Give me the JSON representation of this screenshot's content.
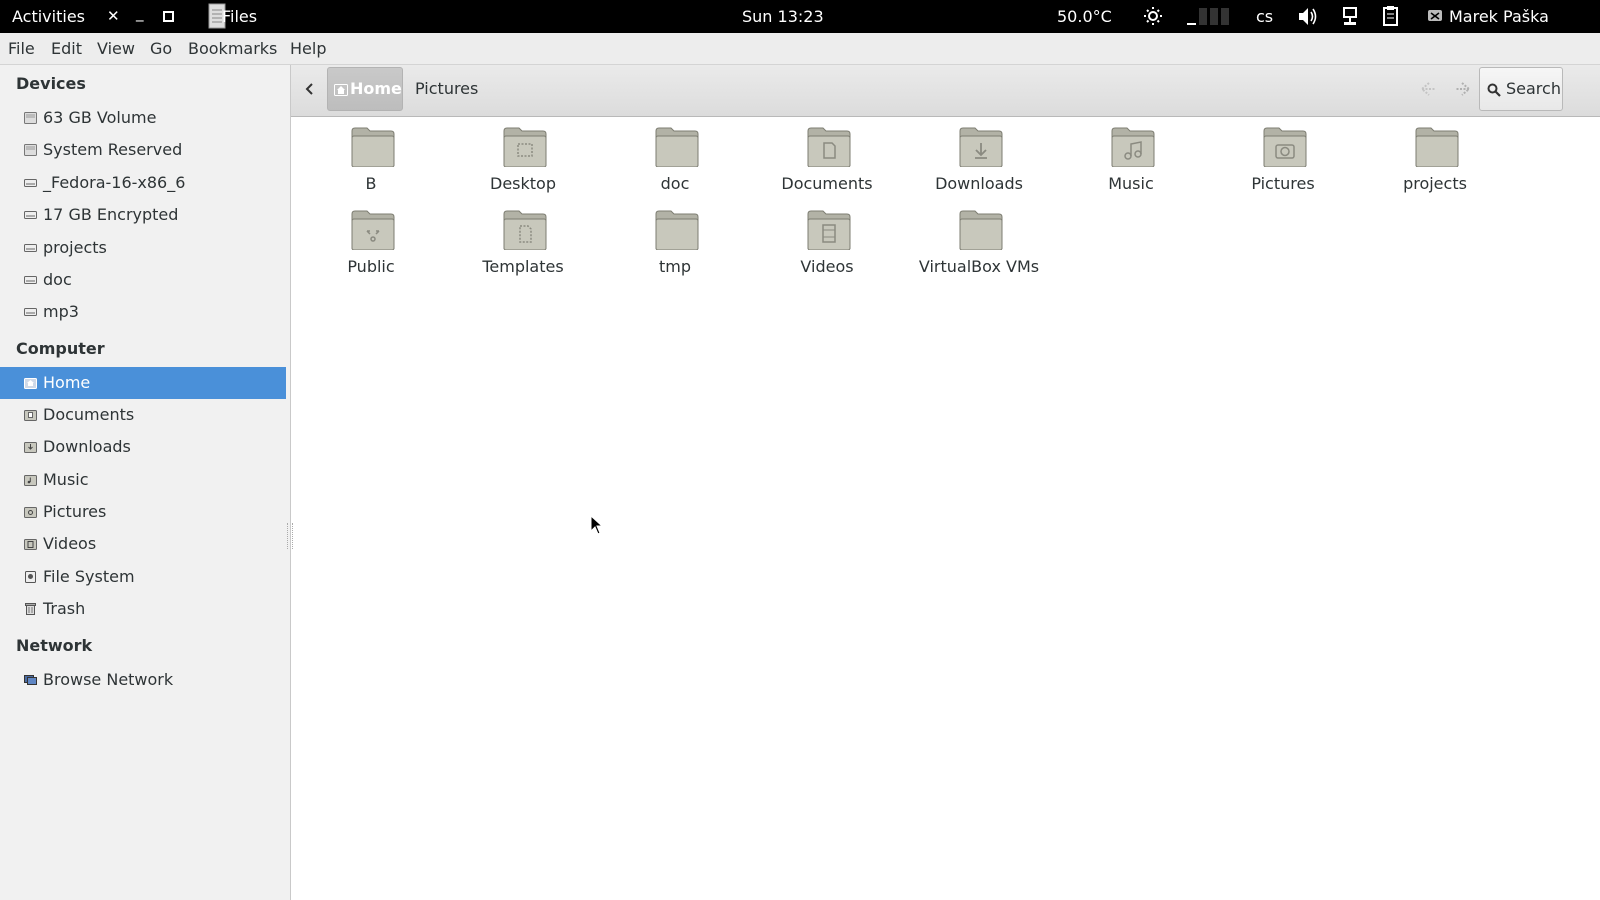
{
  "top_panel": {
    "activities": "Activities",
    "app_name": "Files",
    "clock": "Sun 13:23",
    "temperature": "50.0°C",
    "keyboard_layout": "cs",
    "user_name": "Marek Paška",
    "icons": [
      "close-icon",
      "minimize-icon",
      "maximize-icon",
      "files-app-icon",
      "brightness-icon",
      "battery-icon",
      "volume-icon",
      "network-icon",
      "clipboard-icon",
      "user-icon"
    ]
  },
  "menu": {
    "items": [
      "File",
      "Edit",
      "View",
      "Go",
      "Bookmarks",
      "Help"
    ]
  },
  "sidebar": {
    "sections": [
      {
        "title": "Devices",
        "items": [
          {
            "label": "63 GB Volume",
            "icon": "drive-icon"
          },
          {
            "label": "System Reserved",
            "icon": "drive-icon"
          },
          {
            "label": "_Fedora-16-x86_6",
            "icon": "drive-icon"
          },
          {
            "label": "17 GB Encrypted",
            "icon": "drive-icon"
          },
          {
            "label": "projects",
            "icon": "drive-icon"
          },
          {
            "label": "doc",
            "icon": "drive-icon"
          },
          {
            "label": "mp3",
            "icon": "drive-icon"
          }
        ]
      },
      {
        "title": "Computer",
        "items": [
          {
            "label": "Home",
            "icon": "home-folder-icon",
            "active": true
          },
          {
            "label": "Documents",
            "icon": "documents-folder-icon"
          },
          {
            "label": "Downloads",
            "icon": "downloads-folder-icon"
          },
          {
            "label": "Music",
            "icon": "music-folder-icon"
          },
          {
            "label": "Pictures",
            "icon": "pictures-folder-icon"
          },
          {
            "label": "Videos",
            "icon": "videos-folder-icon"
          },
          {
            "label": "File System",
            "icon": "filesystem-icon"
          },
          {
            "label": "Trash",
            "icon": "trash-icon"
          }
        ]
      },
      {
        "title": "Network",
        "items": [
          {
            "label": "Browse Network",
            "icon": "network-icon"
          }
        ]
      }
    ]
  },
  "toolbar": {
    "breadcrumb": [
      "Home",
      "Pictures"
    ],
    "search_label": "Search"
  },
  "files": [
    {
      "name": "B",
      "icon": "folder"
    },
    {
      "name": "Desktop",
      "icon": "desktop"
    },
    {
      "name": "doc",
      "icon": "folder"
    },
    {
      "name": "Documents",
      "icon": "documents"
    },
    {
      "name": "Downloads",
      "icon": "downloads"
    },
    {
      "name": "Music",
      "icon": "music"
    },
    {
      "name": "Pictures",
      "icon": "pictures"
    },
    {
      "name": "projects",
      "icon": "folder"
    },
    {
      "name": "Public",
      "icon": "public"
    },
    {
      "name": "Templates",
      "icon": "templates"
    },
    {
      "name": "tmp",
      "icon": "folder"
    },
    {
      "name": "Videos",
      "icon": "videos"
    },
    {
      "name": "VirtualBox VMs",
      "icon": "folder"
    }
  ],
  "colors": {
    "accent": "#4a90d9",
    "panel": "#000000",
    "folder": "#b2b2a6"
  }
}
